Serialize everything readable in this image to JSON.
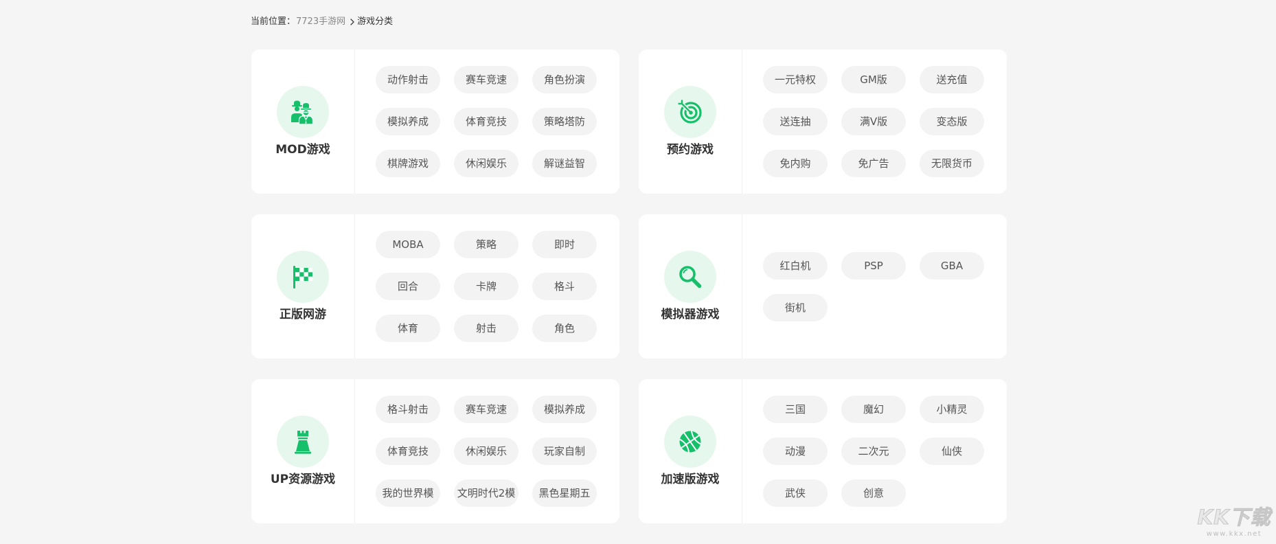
{
  "breadcrumb": {
    "prefix": "当前位置：",
    "home": "7723手游网",
    "separator_icon": "chevron-right-icon",
    "current": "游戏分类"
  },
  "theme": {
    "accent": "#16c06a",
    "accent_light": "#e6f8ee",
    "tag_bg": "#f3f3f3",
    "page_bg": "#f5f5f5"
  },
  "categories": [
    {
      "name": "MOD游戏",
      "icon": "spy-icon",
      "tags": [
        "动作射击",
        "赛车竞速",
        "角色扮演",
        "模拟养成",
        "体育竞技",
        "策略塔防",
        "棋牌游戏",
        "休闲娱乐",
        "解谜益智"
      ]
    },
    {
      "name": "预约游戏",
      "icon": "target-icon",
      "tags": [
        "一元特权",
        "GM版",
        "送充值",
        "送连抽",
        "满V版",
        "变态版",
        "免内购",
        "免广告",
        "无限货币"
      ]
    },
    {
      "name": "正版网游",
      "icon": "checkered-flag-icon",
      "tags": [
        "MOBA",
        "策略",
        "即时",
        "回合",
        "卡牌",
        "格斗",
        "体育",
        "射击",
        "角色"
      ]
    },
    {
      "name": "模拟器游戏",
      "icon": "magnifier-icon",
      "tags": [
        "红白机",
        "PSP",
        "GBA",
        "街机"
      ]
    },
    {
      "name": "UP资源游戏",
      "icon": "tower-icon",
      "tags": [
        "格斗射击",
        "赛车竞速",
        "模拟养成",
        "体育竞技",
        "休闲娱乐",
        "玩家自制",
        "我的世界模",
        "文明时代2模",
        "黑色星期五"
      ]
    },
    {
      "name": "加速版游戏",
      "icon": "basketball-icon",
      "tags": [
        "三国",
        "魔幻",
        "小精灵",
        "动漫",
        "二次元",
        "仙侠",
        "武侠",
        "创意"
      ]
    }
  ],
  "watermark": {
    "brand": "KK下载",
    "url": "www.kkx.net"
  }
}
